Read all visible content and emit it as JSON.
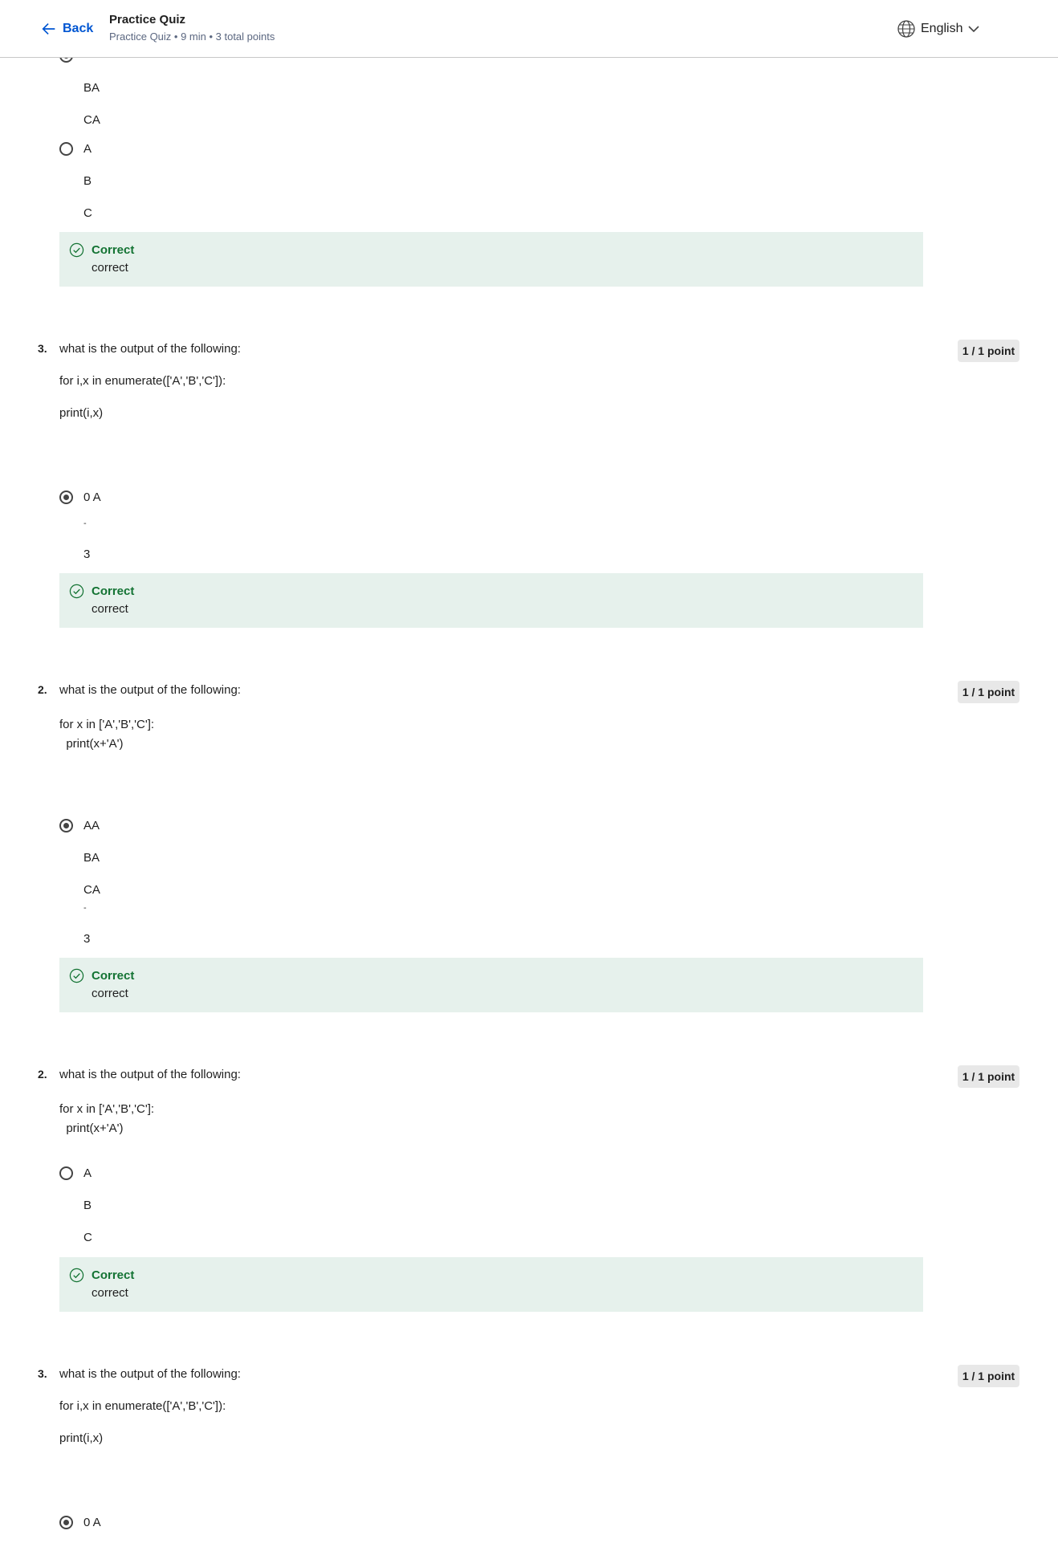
{
  "header": {
    "back_label": "Back",
    "title": "Practice Quiz",
    "subtitle": "Practice Quiz • 9 min • 3 total points",
    "language": "English"
  },
  "block0": {
    "options_top": [
      "BA",
      "CA"
    ],
    "option_a": "A",
    "option_b": "B",
    "option_c": "C",
    "feedback_title": "Correct",
    "feedback_text": "correct"
  },
  "q1": {
    "number": "3.",
    "prompt": "what is the output of the following:",
    "code1": "for i,x in enumerate(['A','B','C']):",
    "code2": "print(i,x)",
    "points": "1 / 1 point",
    "option_selected": "0 A",
    "trailing_dash": "-",
    "trailing_num": "3",
    "feedback_title": "Correct",
    "feedback_text": "correct"
  },
  "q2": {
    "number": "2.",
    "prompt": "what is the output of the following:",
    "code": "for x in ['A','B','C']:\n  print(x+'A')",
    "points": "1 / 1 point",
    "option_selected": "AA",
    "option_2": "BA",
    "option_3": "CA",
    "trailing_dash": "-",
    "trailing_num": "3",
    "feedback_title": "Correct",
    "feedback_text": "correct"
  },
  "q3": {
    "number": "2.",
    "prompt": "what is the output of the following:",
    "code": "for x in ['A','B','C']:\n  print(x+'A')",
    "points": "1 / 1 point",
    "option_a": "A",
    "option_b": "B",
    "option_c": "C",
    "feedback_title": "Correct",
    "feedback_text": "correct"
  },
  "q4": {
    "number": "3.",
    "prompt": "what is the output of the following:",
    "code1": "for i,x in enumerate(['A','B','C']):",
    "code2": "print(i,x)",
    "points": "1 / 1 point",
    "option_selected": "0 A"
  }
}
